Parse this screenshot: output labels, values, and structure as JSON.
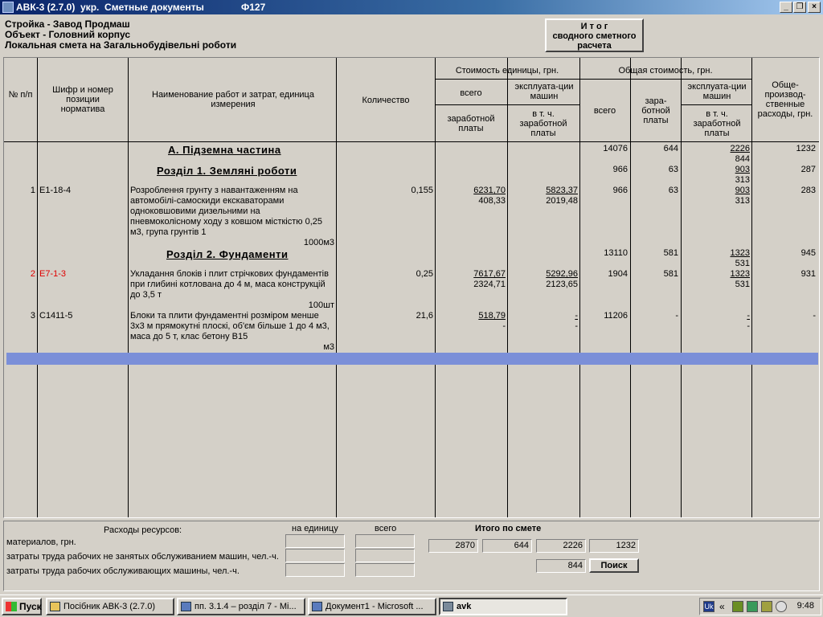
{
  "window": {
    "title": "АВК-3 (2.7.0)  укр.  Сметные документы",
    "form": "Ф127",
    "min_glyph": "_",
    "max_glyph": "❐",
    "close_glyph": "×"
  },
  "header": {
    "line1": "Стройка - Завод Продмаш",
    "line2": "Объект - Головний корпус",
    "line3": "Локальная смета на Загальнобудівельні роботи",
    "total_button": [
      "И т о г",
      "сводного сметного",
      "расчета"
    ]
  },
  "columns": {
    "num": "№ п/п",
    "cipher": "Шифр и номер позиции норматива",
    "name": "Наименование работ и затрат, единица измерения",
    "qty": "Количество",
    "unit_cost": "Стоимость единицы, грн.",
    "total_cost": "Общая стоимость, грн.",
    "all": "всего",
    "salary": "заработной платы",
    "machines": "эксплуата-ции машин",
    "incl_salary": "в т. ч. заработной платы",
    "salary_short": "зара-ботной платы",
    "overhead": "Обще-производ-ственные расходы, грн."
  },
  "sections": {
    "a": {
      "title": "А.   Підземна частина",
      "total": "14076",
      "salary": "644",
      "mach": "2226",
      "mach_sal": "844",
      "overhead": "1232"
    },
    "s1": {
      "title": "Розділ 1. Земляні роботи",
      "total": "966",
      "salary": "63",
      "mach": "903",
      "mach_sal": "313",
      "overhead": "287"
    },
    "s2": {
      "title": "Розділ 2. Фундаменти",
      "total": "13110",
      "salary": "581",
      "mach": "1323",
      "mach_sal": "531",
      "overhead": "945"
    }
  },
  "rows": [
    {
      "num": "1",
      "cipher": "Е1-18-4",
      "name": [
        "Розроблення грунту з навантаженням на",
        "автомобілі-самоскиди екскаваторами",
        "одноковшовими дизельними на",
        "пневмоколісному ходу з ковшом місткістю 0,25",
        "м3, група грунтів 1"
      ],
      "unit": "1000м3",
      "qty": "0,155",
      "u_all": "6231,70",
      "u_sal": "408,33",
      "u_mach": "5823,37",
      "u_mach_sal": "2019,48",
      "t_all": "966",
      "t_sal": "63",
      "t_mach": "903",
      "t_mach_sal": "313",
      "overhead": "283"
    },
    {
      "num": "2",
      "cipher": "Е7-1-3",
      "name": [
        "Укладання блоків і плит стрічкових фундаментів",
        "при глибині котлована до 4 м, маса конструкцій",
        "до 3,5 т"
      ],
      "unit": "100шт",
      "qty": "0,25",
      "u_all": "7617,67",
      "u_sal": "2324,71",
      "u_mach": "5292,96",
      "u_mach_sal": "2123,65",
      "t_all": "1904",
      "t_sal": "581",
      "t_mach": "1323",
      "t_mach_sal": "531",
      "overhead": "931"
    },
    {
      "num": "3",
      "cipher": "С1411-5",
      "name": [
        "Блоки та плити фундаментні розміром менше",
        "3х3 м прямокутні плоскі, об'єм більше 1 до 4 м3,",
        "маса до 5 т, клас бетону В15"
      ],
      "unit": "м3",
      "qty": "21,6",
      "u_all": "518,79",
      "u_sal": "-",
      "u_mach": "-",
      "u_mach_sal": "-",
      "t_all": "11206",
      "t_sal": "-",
      "t_mach": "-",
      "t_mach_sal": "-",
      "overhead": "-"
    }
  ],
  "bottom": {
    "resources_title": "Расходы ресурсов:",
    "per_unit": "на единицу",
    "total": "всего",
    "materials": "материалов, грн.",
    "labor_non_machine": "затраты труда рабочих не занятых обслуживанием машин, чел.-ч.",
    "labor_machine": "затраты труда рабочих обслуживающих машины, чел.-ч.",
    "itogo_label": "Итого   по   смете",
    "itogo_values": [
      "2870",
      "644",
      "2226",
      "1232"
    ],
    "itogo_mach_sal": "844",
    "search_button": "Поиск"
  },
  "taskbar": {
    "start": "Пуск",
    "tasks": [
      "Посібник АВК-3 (2.7.0)",
      "пп. 3.1.4 – розділ 7 - Mi...",
      "Документ1 - Microsoft ...",
      "avk"
    ],
    "lang": "Uk",
    "chevron": "«",
    "clock": "9:48"
  }
}
